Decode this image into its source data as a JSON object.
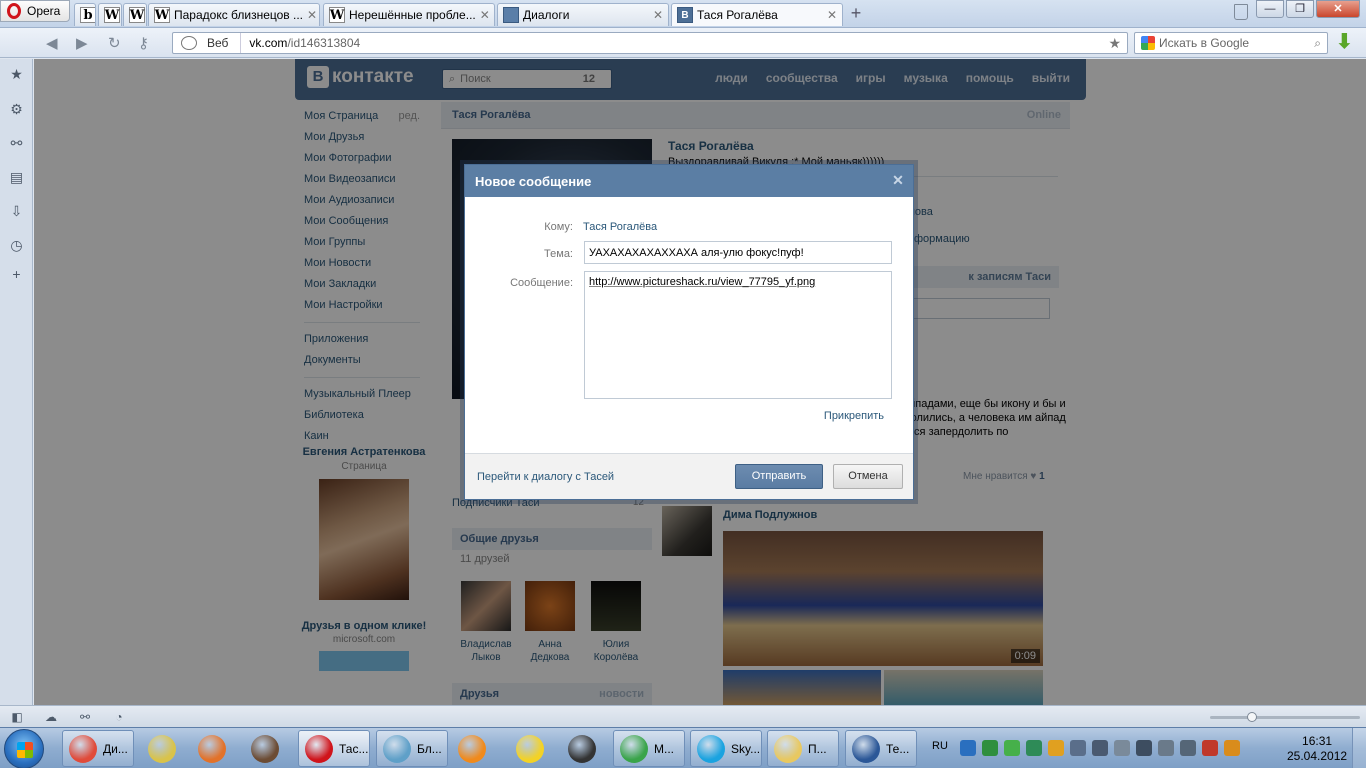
{
  "browser": {
    "menu_label": "Opera",
    "tabs": [
      {
        "icon": "b",
        "title": ""
      },
      {
        "icon": "W",
        "title": ""
      },
      {
        "icon": "W",
        "title": ""
      },
      {
        "icon": "W",
        "title": "Парадокс близнецов ..."
      },
      {
        "icon": "W",
        "title": "Нерешённые пробле..."
      },
      {
        "icon": "chat",
        "title": "Диалоги"
      },
      {
        "icon": "В",
        "title": "Тася Рогалёва"
      }
    ],
    "new_tab": "+",
    "web_label": "Веб",
    "url_host": "vk.com",
    "url_path": "/id146313804",
    "search_placeholder": "Искать в Google"
  },
  "vk": {
    "logo_text": "контакте",
    "logo_letter": "В",
    "search_placeholder": "Поиск",
    "search_count": "12",
    "nav": [
      "люди",
      "сообщества",
      "игры",
      "музыка",
      "помощь",
      "выйти"
    ],
    "menu": {
      "edit_label": "ред.",
      "group1": [
        "Моя Страница",
        "Мои Друзья",
        "Мои Фотографии",
        "Мои Видеозаписи",
        "Мои Аудиозаписи",
        "Мои Сообщения",
        "Мои Группы",
        "Мои Новости",
        "Мои Закладки",
        "Мои Настройки"
      ],
      "group2": [
        "Приложения",
        "Документы"
      ],
      "group3": [
        "Музыкальный Плеер",
        "Библиотека",
        "Каин"
      ]
    },
    "ad": {
      "title": "Евгения Астратенкова",
      "subtitle": "Страница",
      "title2": "Друзья в одном клике!",
      "subtitle2": "microsoft.com"
    },
    "profile": {
      "name": "Тася Рогалёва",
      "online": "Online",
      "status": "Выздоравливай Викуля :* Мой маньяк))))))",
      "info1": "кнова",
      "info2": "формацию",
      "wall_link": "к записям Таси",
      "wall_text": "айпадами, еще бы икону и бы и молились, а человека им айпад ится запердолить по",
      "likes_label": "Мне нравится",
      "likes_count": "1",
      "subs_label": "Подписчики Таси",
      "subs_count": "12",
      "common_friends_title": "Общие друзья",
      "common_friends_count": "11 друзей",
      "friends": [
        {
          "first": "Владислав",
          "last": "Лыков"
        },
        {
          "first": "Анна",
          "last": "Дедкова"
        },
        {
          "first": "Юлия",
          "last": "Королёва"
        }
      ],
      "friends_title": "Друзья",
      "friends_news": "новости",
      "post_author": "Дима Подлужнов",
      "video_duration": "0:09"
    }
  },
  "modal": {
    "title": "Новое сообщение",
    "to_label": "Кому:",
    "to_value": "Тася Рогалёва",
    "subject_label": "Тема:",
    "subject_value": "УАХАХАХАХАХХАХА аля-улю фокус!пуф!",
    "message_label": "Сообщение:",
    "message_value": "http://www.pictureshack.ru/view_77795_yf.png",
    "attach_label": "Прикрепить",
    "goto_dialog": "Перейти к диалогу с Тасей",
    "send_label": "Отправить",
    "cancel_label": "Отмена"
  },
  "taskbar": {
    "apps": [
      {
        "label": "Ди...",
        "color": "#e04b3a"
      },
      {
        "label": "",
        "color": "#d9c34a"
      },
      {
        "label": "",
        "color": "#e2722a"
      },
      {
        "label": "",
        "color": "#6c4c34"
      },
      {
        "label": "Тас...",
        "color": "#d0141b"
      },
      {
        "label": "Бл...",
        "color": "#5fa0c8"
      },
      {
        "label": "",
        "color": "#f08a1c"
      },
      {
        "label": "",
        "color": "#f3d226"
      },
      {
        "label": "",
        "color": "#333333"
      },
      {
        "label": "М...",
        "color": "#3aa44a"
      },
      {
        "label": "Sky...",
        "color": "#1aa3e0"
      },
      {
        "label": "П...",
        "color": "#e8c860"
      },
      {
        "label": "Те...",
        "color": "#2b5797"
      }
    ],
    "lang": "RU",
    "time": "16:31",
    "date": "25.04.2012"
  }
}
